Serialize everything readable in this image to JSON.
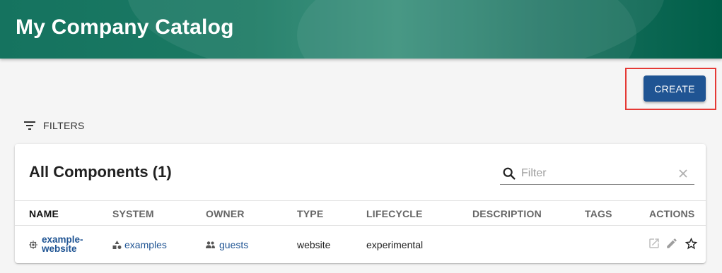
{
  "header": {
    "title": "My Company Catalog"
  },
  "toolbar": {
    "create_label": "CREATE",
    "filters_label": "FILTERS"
  },
  "card": {
    "title": "All Components (1)",
    "filter_placeholder": "Filter"
  },
  "table": {
    "columns": [
      "NAME",
      "SYSTEM",
      "OWNER",
      "TYPE",
      "LIFECYCLE",
      "DESCRIPTION",
      "TAGS",
      "ACTIONS"
    ],
    "rows": [
      {
        "name_line1": "example-",
        "name_line2": "website",
        "system": "examples",
        "owner": "guests",
        "type": "website",
        "lifecycle": "experimental",
        "description": "",
        "tags": ""
      }
    ]
  },
  "colors": {
    "accent": "#1f5493",
    "header_green": "#1b7a64",
    "highlight": "#e53935"
  },
  "icons": {
    "filters": "filter-list-icon",
    "search": "search-icon",
    "clear": "close-icon",
    "component": "component-icon",
    "system": "system-icon",
    "owner": "group-icon",
    "view": "open-in-new-icon",
    "edit": "pencil-icon",
    "star": "star-outline-icon"
  }
}
